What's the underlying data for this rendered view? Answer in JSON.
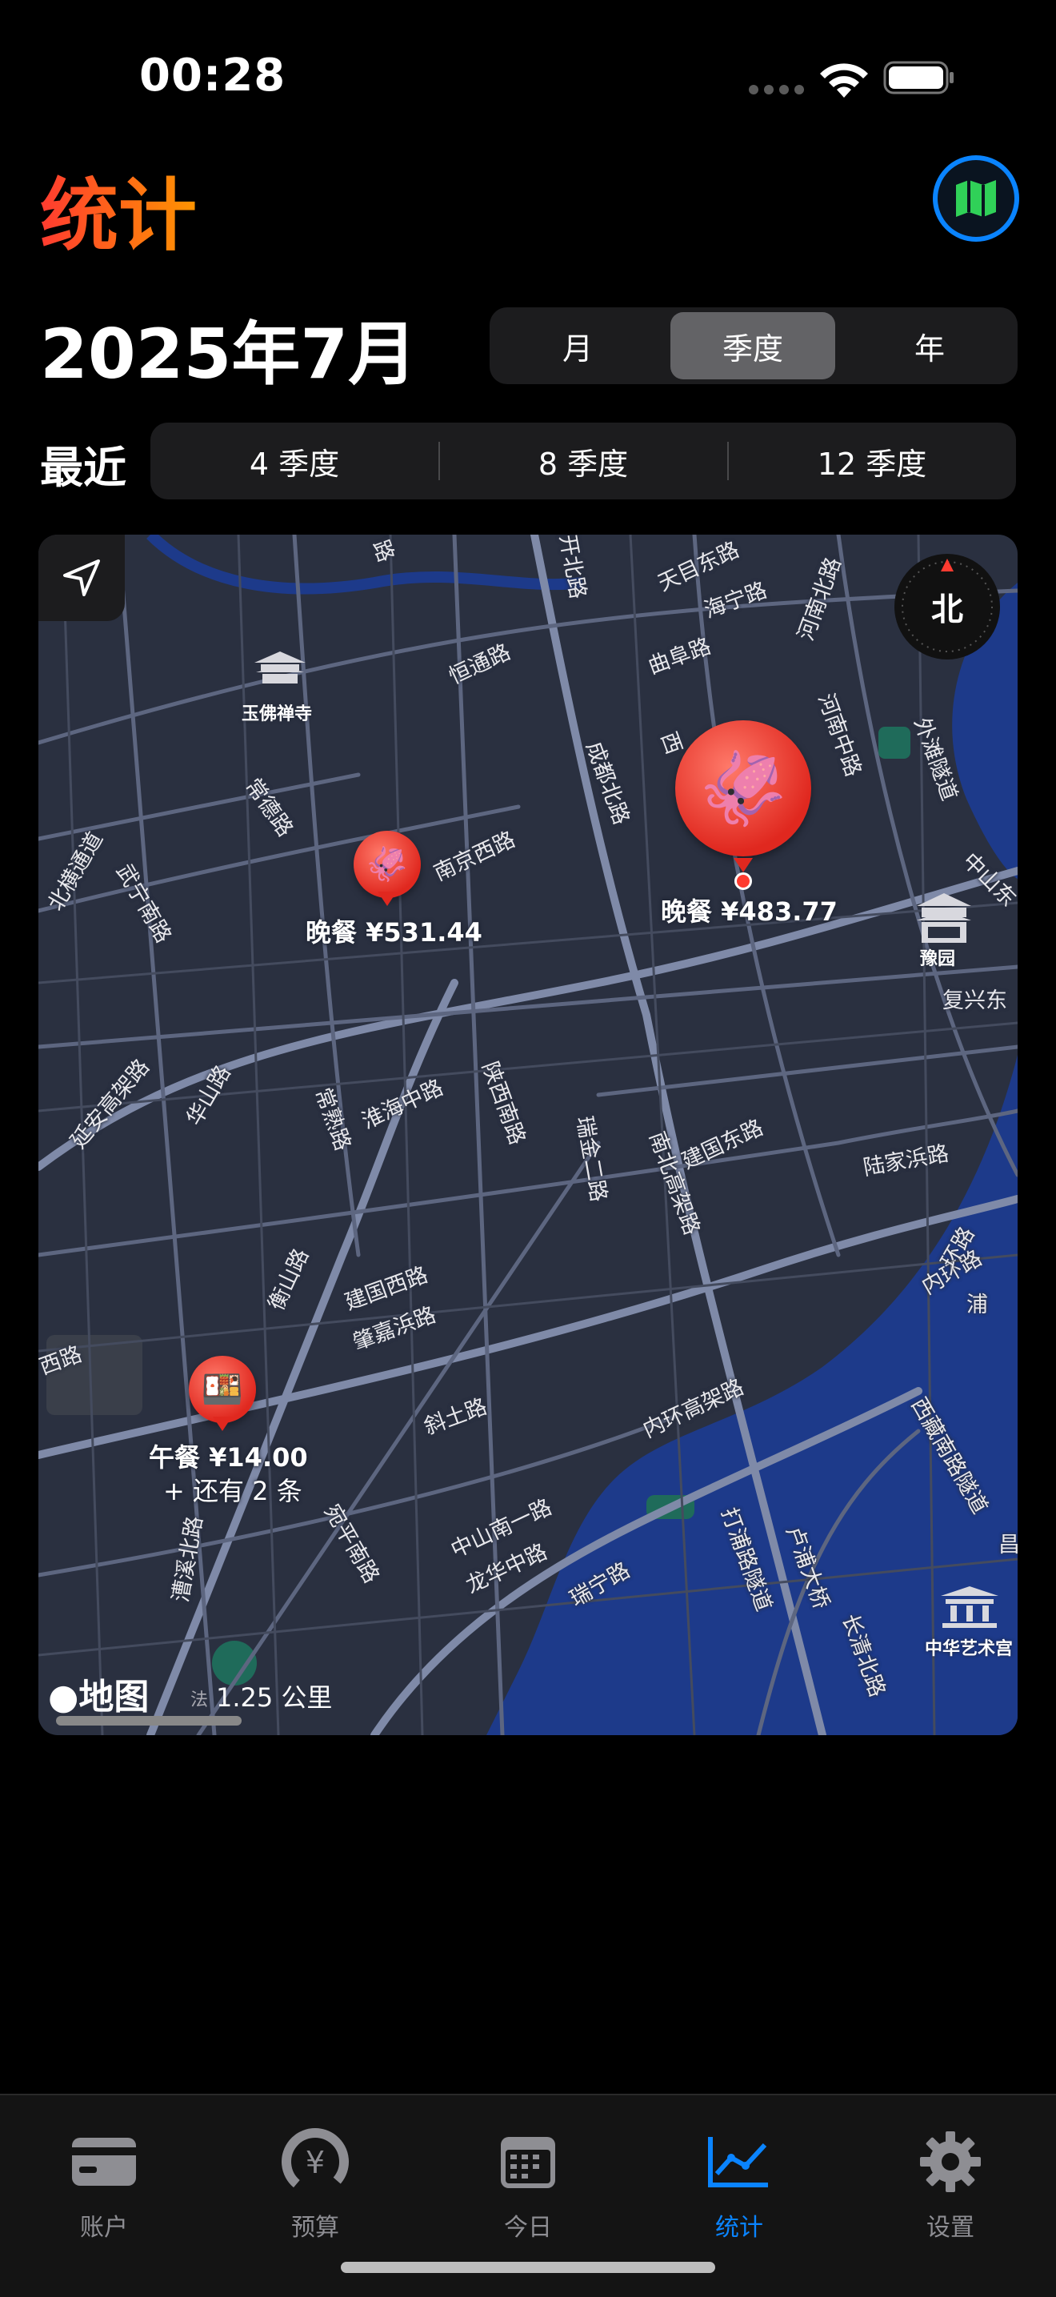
{
  "status_bar": {
    "time": "00:28"
  },
  "header": {
    "title": "统计",
    "map_button_icon": "map-icon"
  },
  "period": {
    "title": "2025年7月",
    "segments": [
      "月",
      "季度",
      "年"
    ],
    "selected": "季度"
  },
  "recent": {
    "label": "最近",
    "options": [
      "4 季度",
      "8 季度",
      "12 季度"
    ]
  },
  "map": {
    "compass": "北",
    "logo": "地图",
    "legal": "法",
    "scale": "1.25 公里",
    "pins": [
      {
        "label": "晚餐 ¥531.44",
        "icon": "squid"
      },
      {
        "label": "晚餐 ¥483.77",
        "icon": "squid"
      },
      {
        "label": "午餐 ¥14.00",
        "sub": "+ 还有 2 条",
        "icon": "bento"
      }
    ],
    "pois": [
      "玉佛禅寺",
      "豫园",
      "中华艺术宫"
    ],
    "roads": [
      "天目东路",
      "海宁路",
      "河南北路",
      "恒通路",
      "曲阜路",
      "常德路",
      "南京西路",
      "成都北路",
      "河南中路",
      "外滩隧道",
      "中山东",
      "北横通道",
      "武宁南路",
      "复兴东",
      "延安高架路",
      "华山路",
      "常熟路",
      "淮海中路",
      "陕西南路",
      "瑞金二路",
      "南北高架路",
      "建国东路",
      "陆家浜路",
      "衡山路",
      "建国西路",
      "肇嘉浜路",
      "斜土路",
      "内环高架路",
      "西藏南路隧道",
      "内环路",
      "中山南一路",
      "龙华中路",
      "瑞宁路",
      "打浦路隧道",
      "卢浦大桥",
      "长清北路",
      "宛平南路",
      "漕溪北路",
      "西路",
      "昌",
      "环路",
      "浦",
      "路",
      "开北路",
      "西"
    ]
  },
  "tabbar": {
    "items": [
      {
        "label": "账户",
        "icon": "card-icon"
      },
      {
        "label": "预算",
        "icon": "gauge-yen-icon"
      },
      {
        "label": "今日",
        "icon": "calendar-icon"
      },
      {
        "label": "统计",
        "icon": "chart-icon"
      },
      {
        "label": "设置",
        "icon": "gear-icon"
      }
    ],
    "active": "统计"
  },
  "colors": {
    "accent": "#0a84ff",
    "title_gradient": [
      "#ff3b30",
      "#ff9500"
    ],
    "pin": "#e0281f"
  }
}
